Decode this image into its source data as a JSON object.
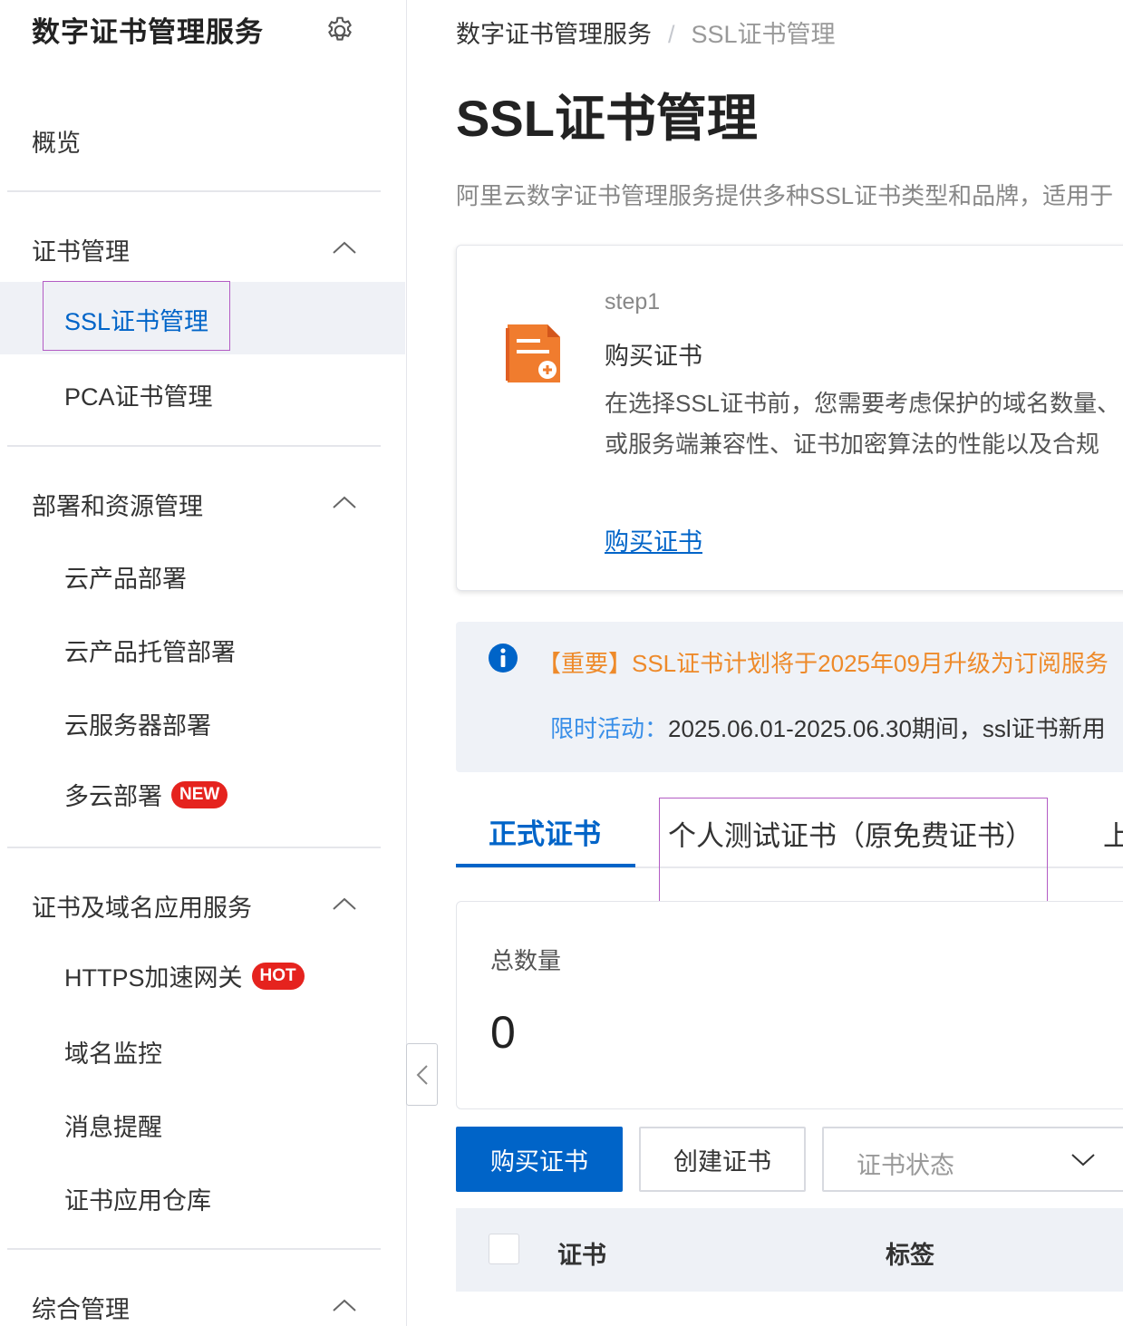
{
  "sidebar": {
    "title": "数字证书管理服务",
    "overview": "概览",
    "groups": [
      {
        "label": "证书管理",
        "items": [
          "SSL证书管理",
          "PCA证书管理"
        ]
      },
      {
        "label": "部署和资源管理",
        "items": [
          "云产品部署",
          "云产品托管部署",
          "云服务器部署",
          "多云部署"
        ]
      },
      {
        "label": "证书及域名应用服务",
        "items": [
          "HTTPS加速网关",
          "域名监控",
          "消息提醒",
          "证书应用仓库"
        ]
      },
      {
        "label": "综合管理"
      }
    ],
    "badges": {
      "new": "NEW",
      "hot": "HOT"
    },
    "active_item": "SSL证书管理"
  },
  "breadcrumb": {
    "root": "数字证书管理服务",
    "separator": "/",
    "current": "SSL证书管理"
  },
  "page": {
    "title": "SSL证书管理",
    "description": "阿里云数字证书管理服务提供多种SSL证书类型和品牌，适用于"
  },
  "step_card": {
    "step": "step1",
    "title": "购买证书",
    "text_line1": "在选择SSL证书前，您需要考虑保护的域名数量、",
    "text_line2": "或服务端兼容性、证书加密算法的性能以及合规",
    "link": "购买证书"
  },
  "notice": {
    "line1": "【重要】SSL证书计划将于2025年09月升级为订阅服务",
    "line2_label": "限时活动：",
    "line2_text": "2025.06.01-2025.06.30期间，ssl证书新用"
  },
  "tabs": [
    "正式证书",
    "个人测试证书（原免费证书）",
    "上"
  ],
  "stats": {
    "label": "总数量",
    "value": "0"
  },
  "toolbar": {
    "buy_label": "购买证书",
    "create_label": "创建证书",
    "status_placeholder": "证书状态"
  },
  "table": {
    "columns": [
      "证书",
      "标签"
    ]
  },
  "colors": {
    "primary": "#0064c8",
    "badge": "#e5231e",
    "notice_orange": "#ee8a2a",
    "highlight_box": "#b35cc4"
  }
}
